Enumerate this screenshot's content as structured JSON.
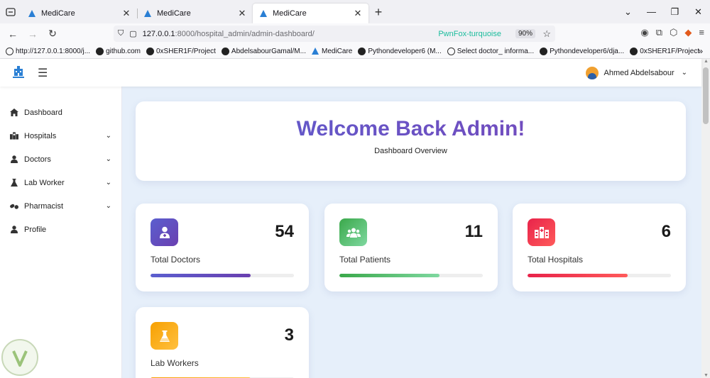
{
  "browser": {
    "tabs": [
      {
        "title": "MediCare",
        "active": false
      },
      {
        "title": "MediCare",
        "active": false
      },
      {
        "title": "MediCare",
        "active": true
      }
    ],
    "url_host": "127.0.0.1",
    "url_path": ":8000/hospital_admin/admin-dashboard/",
    "container_label": "PwnFox-turquoise",
    "zoom": "90%",
    "bookmarks": [
      {
        "label": "http://127.0.0.1:8000/j...",
        "icon": "globe-icon"
      },
      {
        "label": "github.com",
        "icon": "github-icon"
      },
      {
        "label": "0xSHER1F/Project",
        "icon": "github-icon"
      },
      {
        "label": "AbdelsabourGamal/M...",
        "icon": "github-icon"
      },
      {
        "label": "MediCare",
        "icon": "medicare-icon"
      },
      {
        "label": "Pythondeveloper6 (M...",
        "icon": "github-icon"
      },
      {
        "label": "Select doctor_ informa...",
        "icon": "globe-icon"
      },
      {
        "label": "Pythondeveloper6/dja...",
        "icon": "github-icon"
      },
      {
        "label": "0xSHER1F/Project",
        "icon": "github-icon"
      }
    ]
  },
  "header": {
    "user_name": "Ahmed Abdelsabour"
  },
  "sidebar": {
    "items": [
      {
        "label": "Dashboard",
        "icon": "home-icon",
        "has_submenu": false
      },
      {
        "label": "Hospitals",
        "icon": "hospital-icon",
        "has_submenu": true
      },
      {
        "label": "Doctors",
        "icon": "doctor-icon",
        "has_submenu": true
      },
      {
        "label": "Lab Worker",
        "icon": "flask-icon",
        "has_submenu": true
      },
      {
        "label": "Pharmacist",
        "icon": "pills-icon",
        "has_submenu": true
      },
      {
        "label": "Profile",
        "icon": "user-icon",
        "has_submenu": false
      }
    ]
  },
  "welcome": {
    "title": "Welcome Back Admin!",
    "subtitle": "Dashboard Overview"
  },
  "stats": [
    {
      "label": "Total Doctors",
      "value": "54",
      "progress": 0.7,
      "color_from": "#5b5fcf",
      "color_to": "#6a3fb0",
      "icon": "doctor-icon"
    },
    {
      "label": "Total Patients",
      "value": "11",
      "progress": 0.7,
      "color_from": "#3aa84a",
      "color_to": "#7fd8a0",
      "icon": "patients-icon"
    },
    {
      "label": "Total Hospitals",
      "value": "6",
      "progress": 0.7,
      "color_from": "#e8234a",
      "color_to": "#ff5a5a",
      "icon": "hospital-icon"
    },
    {
      "label": "Lab Workers",
      "value": "3",
      "progress": 0.7,
      "color_from": "#f7a000",
      "color_to": "#ffc040",
      "icon": "flask-icon"
    }
  ]
}
